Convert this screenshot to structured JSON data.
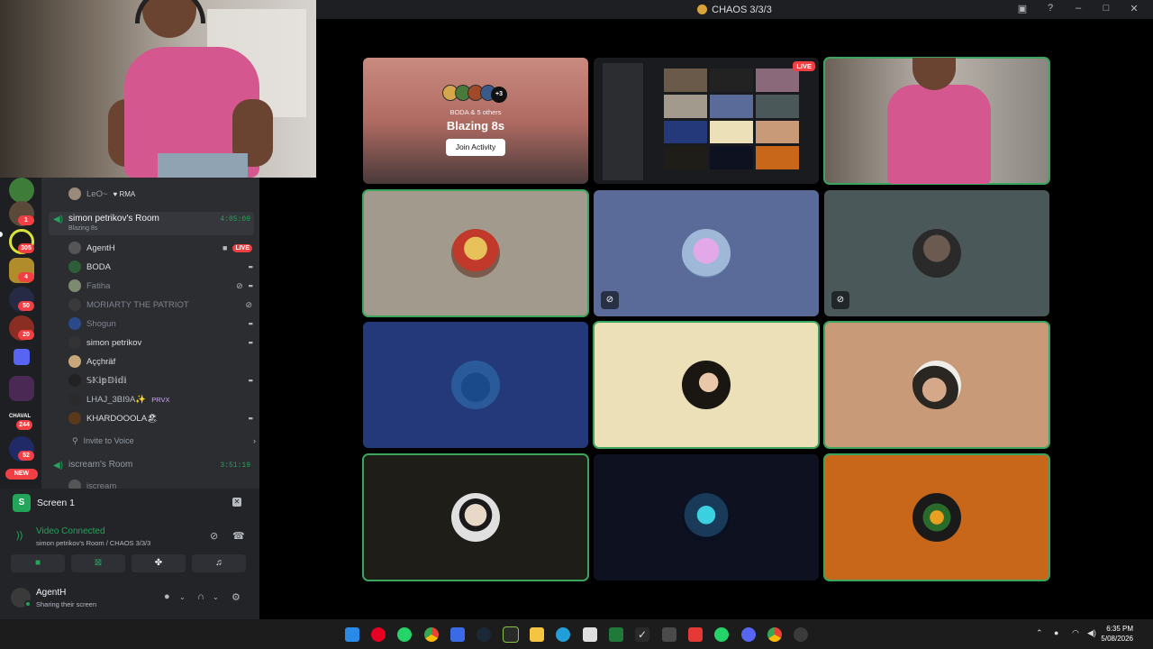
{
  "window": {
    "title": "CHAOS 3/3/3"
  },
  "channel_list": {
    "above_user": "LeO~",
    "above_user_tag": "♥ RMA",
    "room1": {
      "name": "simon petrikov's Room",
      "activity": "Blazing 8s",
      "timer": "4:05:09"
    },
    "members": [
      {
        "name": "AgentH",
        "badge": "LIVE"
      },
      {
        "name": "BODA"
      },
      {
        "name": "Fatiha"
      },
      {
        "name": "MORIARTY THE PATRIOT"
      },
      {
        "name": "Shogun"
      },
      {
        "name": "simon petrikov"
      },
      {
        "name": "Aççhräf"
      },
      {
        "name": "𝕊𝕂𝕚𝕡𝔻𝕚𝕕𝕚"
      },
      {
        "name": "LHAJ_3BI9A✨",
        "tag": "PRVX"
      },
      {
        "name": "KHARDOOOLA🏖"
      }
    ],
    "invite": "Invite to Voice",
    "room2": {
      "name": "iscream's Room",
      "timer": "3:51:19"
    },
    "room2_user": "iscream"
  },
  "guild_badges": [
    "1",
    "305",
    "4",
    "50",
    "20",
    "244",
    "52"
  ],
  "guild_labels": {
    "chaval": "CHAVAL"
  },
  "new_badge": "NEW",
  "panel": {
    "screen_label": "Screen 1",
    "status": "Video Connected",
    "location": "simon petrikov's Room / CHAOS 3/3/3",
    "user_name": "AgentH",
    "user_status": "Sharing their screen"
  },
  "grid": {
    "activity": {
      "others": "BODA & 5 others",
      "plus": "+3",
      "game": "Blazing 8s",
      "button": "Join Activity"
    },
    "live_label": "LIVE"
  },
  "taskbar": {
    "time": "6:35 PM",
    "date": "5/08/2026"
  },
  "colors": {
    "speaking": "#3ba55d",
    "live": "#f23f43",
    "online": "#23a55a"
  }
}
